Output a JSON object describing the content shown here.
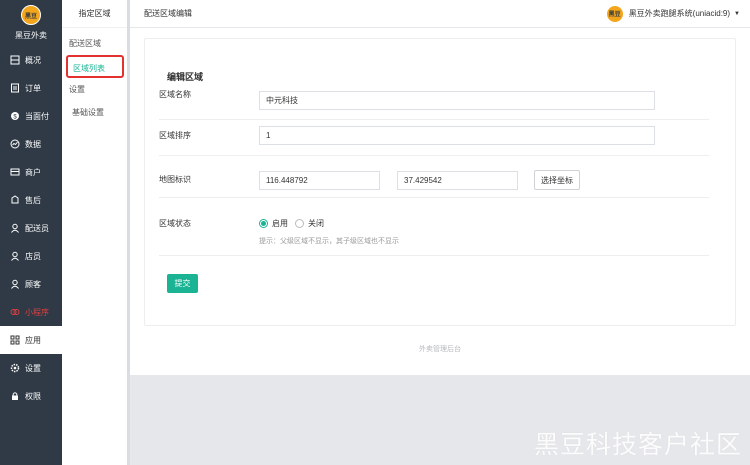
{
  "sidebar": {
    "brand": "黑豆外卖",
    "logo_text": "黑豆",
    "items": [
      {
        "label": "概况",
        "icon": "overview-icon"
      },
      {
        "label": "订单",
        "icon": "order-icon"
      },
      {
        "label": "当面付",
        "icon": "pay-icon"
      },
      {
        "label": "数据",
        "icon": "data-icon"
      },
      {
        "label": "商户",
        "icon": "store-icon"
      },
      {
        "label": "售后",
        "icon": "aftersale-icon"
      },
      {
        "label": "配送员",
        "icon": "courier-icon"
      },
      {
        "label": "店员",
        "icon": "clerk-icon"
      },
      {
        "label": "顾客",
        "icon": "customer-icon"
      },
      {
        "label": "小程序",
        "icon": "miniprogram-icon"
      },
      {
        "label": "应用",
        "icon": "apps-icon"
      },
      {
        "label": "设置",
        "icon": "gear-icon"
      },
      {
        "label": "权限",
        "icon": "lock-icon"
      }
    ]
  },
  "subbar": {
    "title": "指定区域",
    "items": [
      "配送区域",
      "区域列表",
      "设置",
      "基础设置"
    ]
  },
  "header": {
    "title": "配送区域编辑",
    "user": "黑豆外卖跑腿系统(uniacid:9)",
    "caret": "▼"
  },
  "form": {
    "title": "编辑区域",
    "name_label": "区域名称",
    "name_value": "中元科技",
    "sort_label": "区域排序",
    "sort_value": "1",
    "map_label": "地图标识",
    "lng_value": "116.448792",
    "lat_value": "37.429542",
    "pick_button": "选择坐标",
    "status_label": "区域状态",
    "status_on": "启用",
    "status_off": "关闭",
    "status_hint": "提示：父级区域不显示，其子级区域也不显示",
    "submit": "提交"
  },
  "footer": {
    "text": "外卖管理后台",
    "watermark": "黑豆科技客户社区"
  },
  "colors": {
    "sidebar_bg": "#2f3a46",
    "accent": "#1ab394",
    "highlight_border": "#e2312f",
    "miniprogram_red": "#e04040"
  }
}
